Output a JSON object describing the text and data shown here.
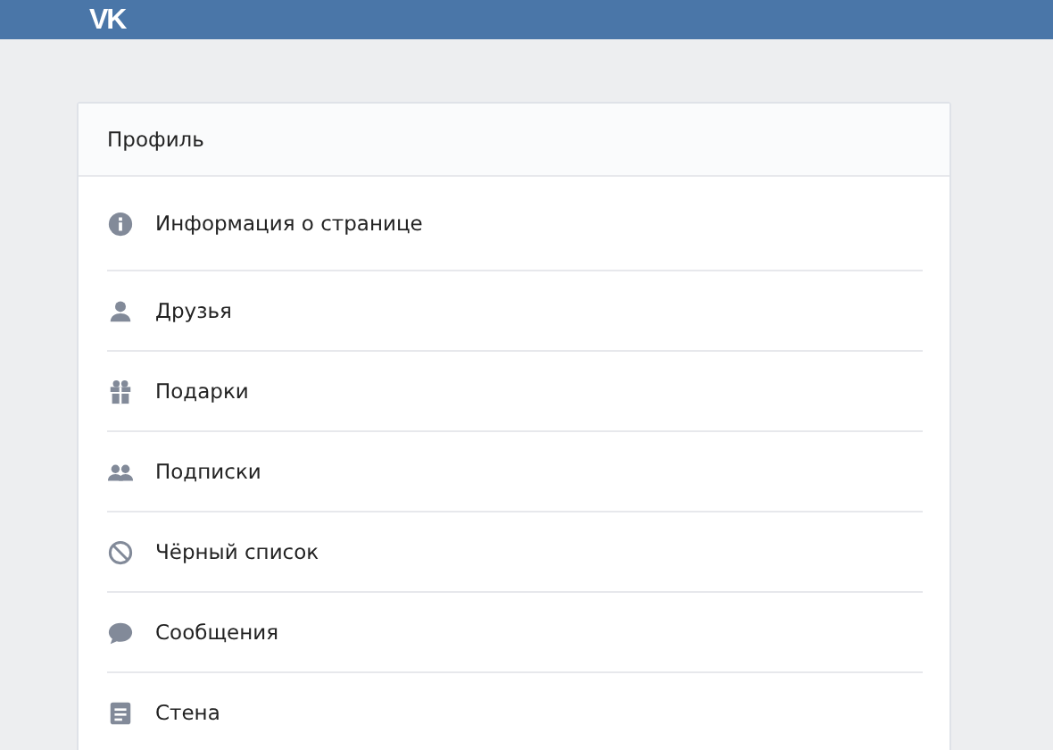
{
  "header": {
    "logo": "VK"
  },
  "card": {
    "title": "Профиль",
    "items": [
      {
        "label": "Информация о странице",
        "kind": "info"
      },
      {
        "label": "Друзья",
        "kind": "person"
      },
      {
        "label": "Подарки",
        "kind": "gift"
      },
      {
        "label": "Подписки",
        "kind": "people"
      },
      {
        "label": "Чёрный список",
        "kind": "block"
      },
      {
        "label": "Сообщения",
        "kind": "chat"
      },
      {
        "label": "Стена",
        "kind": "wall"
      }
    ]
  }
}
